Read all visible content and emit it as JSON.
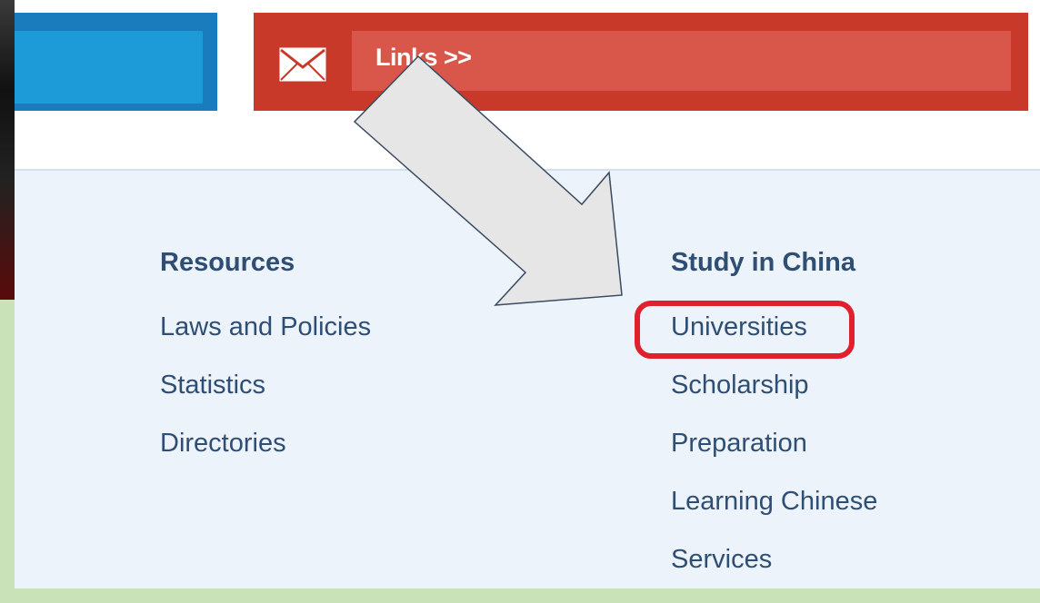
{
  "top_bar": {
    "links_label": "Links >>",
    "mail_icon": "envelope-icon"
  },
  "footer": {
    "resources": {
      "title": "Resources",
      "items": [
        "Laws and Policies",
        "Statistics",
        "Directories"
      ]
    },
    "study_in_china": {
      "title": "Study in China",
      "items": [
        "Universities",
        "Scholarship",
        "Preparation",
        "Learning Chinese",
        "Services"
      ]
    }
  },
  "annotation": {
    "highlight_color": "#e0202c",
    "arrow_color": "#e6e6e6"
  },
  "colors": {
    "blue": "#1d9ad8",
    "red": "#c8392a",
    "link_text": "#2f4e73",
    "footer_bg": "#edf3fb"
  }
}
